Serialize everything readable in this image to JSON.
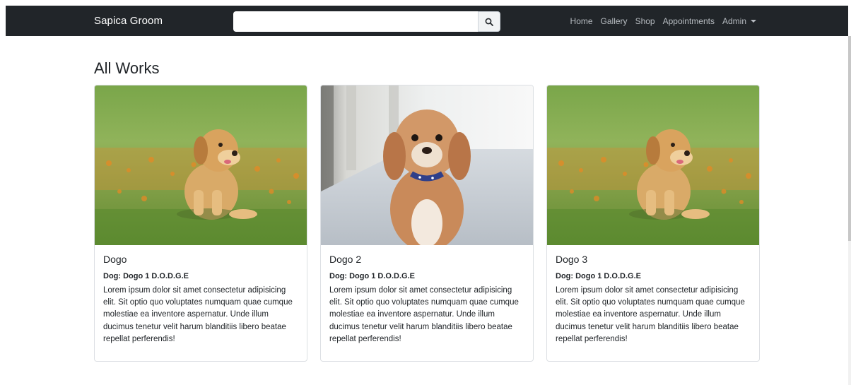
{
  "navbar": {
    "brand": "Sapica Groom",
    "search": {
      "placeholder": "",
      "value": "",
      "icon": "search-icon"
    },
    "links": [
      "Home",
      "Gallery",
      "Shop",
      "Appointments",
      "Admin"
    ],
    "background": "#212529"
  },
  "page": {
    "title": "All Works"
  },
  "cards": [
    {
      "title": "Dogo",
      "subtitle": "Dog: Dogo 1 D.O.D.G.E",
      "text": "Lorem ipsum dolor sit amet consectetur adipisicing elit. Sit optio quo voluptates numquam quae cumque molestiae ea inventore aspernatur. Unde illum ducimus tenetur velit harum blanditiis libero beatae repellat perferendis!",
      "image": "golden-puppy-photo"
    },
    {
      "title": "Dogo 2",
      "subtitle": "Dog: Dogo 1 D.O.D.G.E",
      "text": "Lorem ipsum dolor sit amet consectetur adipisicing elit. Sit optio quo voluptates numquam quae cumque molestiae ea inventore aspernatur. Unde illum ducimus tenetur velit harum blanditiis libero beatae repellat perferendis!",
      "image": "fluffy-dog-photo"
    },
    {
      "title": "Dogo 3",
      "subtitle": "Dog: Dogo 1 D.O.D.G.E",
      "text": "Lorem ipsum dolor sit amet consectetur adipisicing elit. Sit optio quo voluptates numquam quae cumque molestiae ea inventore aspernatur. Unde illum ducimus tenetur velit harum blanditiis libero beatae repellat perferendis!",
      "image": "golden-puppy-photo"
    }
  ]
}
